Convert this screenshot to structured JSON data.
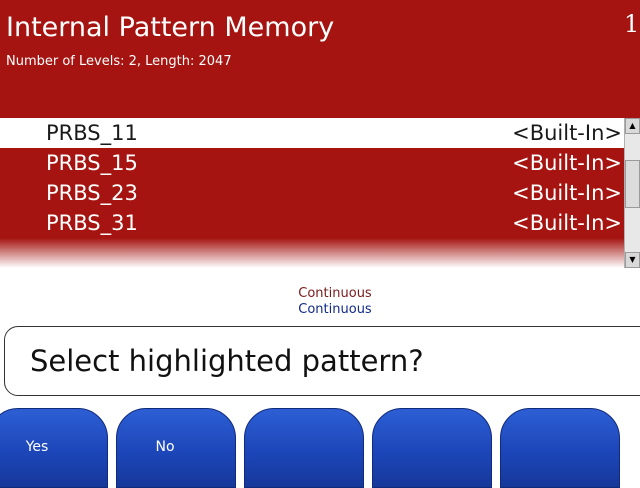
{
  "header": {
    "title": "Internal Pattern Memory",
    "subtitle": "Number of Levels: 2, Length: 2047",
    "page_indicator": "1"
  },
  "patterns": [
    {
      "name": "PRBS_11",
      "tag": "<Built-In>",
      "selected": true
    },
    {
      "name": "PRBS_15",
      "tag": "<Built-In>",
      "selected": false
    },
    {
      "name": "PRBS_23",
      "tag": "<Built-In>",
      "selected": false
    },
    {
      "name": "PRBS_31",
      "tag": "<Built-In>",
      "selected": false
    }
  ],
  "mode_lines": [
    "Continuous",
    "Continuous"
  ],
  "prompt": "Select highlighted pattern?",
  "softkeys": [
    {
      "label": "Yes"
    },
    {
      "label": "No"
    },
    {
      "label": ""
    },
    {
      "label": ""
    },
    {
      "label": ""
    }
  ],
  "colors": {
    "header_bg": "#a51410",
    "softkey_blue": "#1c46b9",
    "mode_line_1": "#7b1a1a",
    "mode_line_2": "#102a8a"
  },
  "icons": {
    "scroll_up": "scroll-up-arrow-icon",
    "scroll_down": "scroll-down-arrow-icon"
  }
}
